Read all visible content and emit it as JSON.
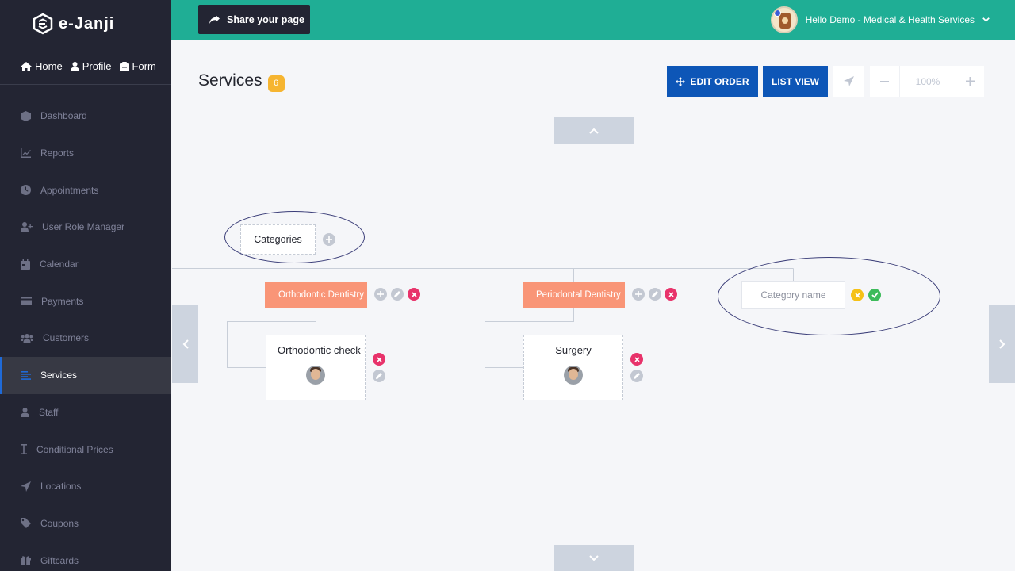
{
  "app": {
    "name": "e-Janji"
  },
  "sidebar": {
    "top_links": [
      {
        "label": "Home",
        "icon": "home-icon"
      },
      {
        "label": "Profile",
        "icon": "user-icon"
      },
      {
        "label": "Form",
        "icon": "form-icon"
      }
    ],
    "items": [
      {
        "label": "Dashboard",
        "icon": "cube-icon"
      },
      {
        "label": "Reports",
        "icon": "chart-line-icon"
      },
      {
        "label": "Appointments",
        "icon": "clock-icon"
      },
      {
        "label": "User Role Manager",
        "icon": "user-plus-icon"
      },
      {
        "label": "Calendar",
        "icon": "calendar-icon"
      },
      {
        "label": "Payments",
        "icon": "credit-card-icon"
      },
      {
        "label": "Customers",
        "icon": "users-icon"
      },
      {
        "label": "Services",
        "icon": "list-icon",
        "active": true
      },
      {
        "label": "Staff",
        "icon": "user-icon"
      },
      {
        "label": "Conditional Prices",
        "icon": "i-beam-icon"
      },
      {
        "label": "Locations",
        "icon": "location-arrow-icon"
      },
      {
        "label": "Coupons",
        "icon": "tag-icon"
      },
      {
        "label": "Giftcards",
        "icon": "gift-icon"
      }
    ]
  },
  "header": {
    "share_label": "Share your page",
    "greeting": "Hello Demo - Medical & Health Services"
  },
  "main": {
    "title": "Services",
    "count": "6",
    "edit_order_label": "EDIT ORDER",
    "list_view_label": "LIST VIEW",
    "zoom": "100%"
  },
  "tree": {
    "root_label": "Categories",
    "categories": [
      {
        "name": "Orthodontic Dentistry"
      },
      {
        "name": "Periodontal Dentistry"
      }
    ],
    "new_category_placeholder": "Category name",
    "services": [
      {
        "name": "Orthodontic check-up"
      },
      {
        "name": "Surgery"
      }
    ]
  },
  "colors": {
    "accent": "#1fae95",
    "sidebar": "#232533",
    "primary_button": "#0d56b7",
    "category": "#f99577",
    "badge": "#f6b531"
  }
}
